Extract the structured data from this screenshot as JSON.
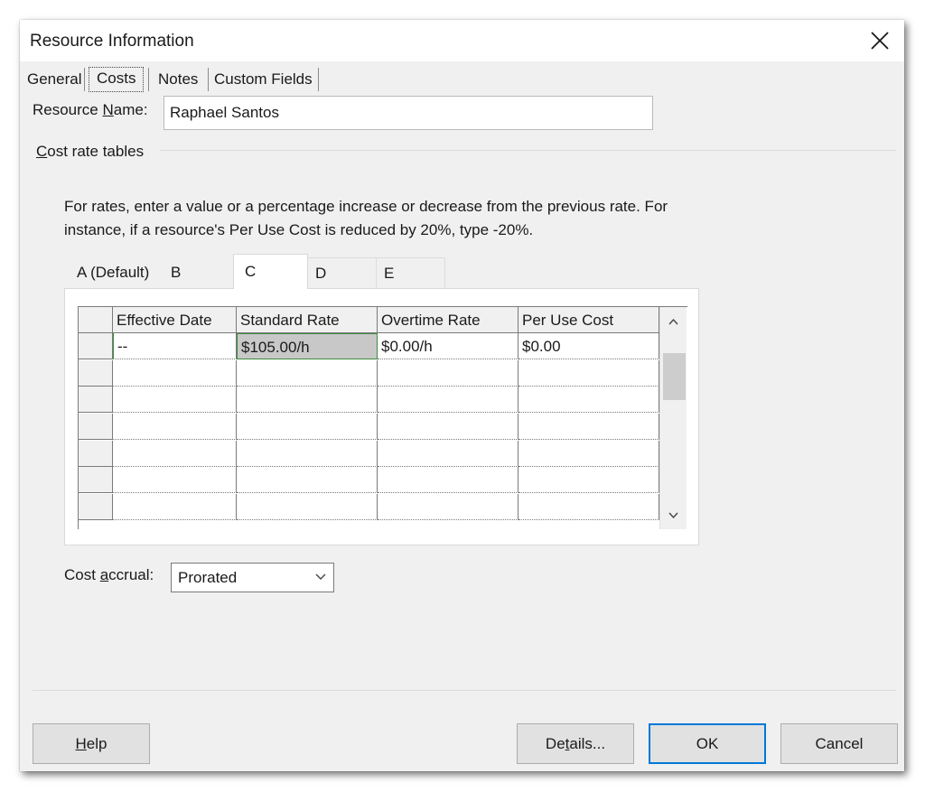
{
  "window": {
    "title": "Resource Information",
    "close_icon": "close-icon"
  },
  "tabs": [
    {
      "label": "General",
      "active": false
    },
    {
      "label": "Costs",
      "active": true
    },
    {
      "label": "Notes",
      "active": false
    },
    {
      "label": "Custom Fields",
      "active": false
    }
  ],
  "resource_name": {
    "label_prefix": "Resource ",
    "label_accel": "N",
    "label_suffix": "ame:",
    "value": "Raphael Santos"
  },
  "cost_rate_tables": {
    "group_label_accel": "C",
    "group_label_rest": "ost rate tables",
    "instructions": "For rates, enter a value or a percentage increase or decrease from the previous rate. For instance, if a resource's Per Use Cost is reduced by 20%, type -20%.",
    "tabs": [
      {
        "label": "A (Default)",
        "active": false
      },
      {
        "label": "B",
        "active": false
      },
      {
        "label": "C",
        "active": true
      },
      {
        "label": "D",
        "active": false
      },
      {
        "label": "E",
        "active": false
      }
    ],
    "columns": [
      "Effective Date",
      "Standard Rate",
      "Overtime Rate",
      "Per Use Cost"
    ],
    "rows": [
      [
        "--",
        "$105.00/h",
        "$0.00/h",
        "$0.00"
      ],
      [
        "",
        "",
        "",
        ""
      ],
      [
        "",
        "",
        "",
        ""
      ],
      [
        "",
        "",
        "",
        ""
      ],
      [
        "",
        "",
        "",
        ""
      ],
      [
        "",
        "",
        "",
        ""
      ],
      [
        "",
        "",
        "",
        ""
      ]
    ],
    "selected_cell": {
      "row": 0,
      "col": 1
    }
  },
  "cost_accrual": {
    "label_prefix": "Cost ",
    "label_accel": "a",
    "label_suffix": "ccrual:",
    "value": "Prorated"
  },
  "buttons": {
    "help_accel": "H",
    "help_rest": "elp",
    "details_prefix": "De",
    "details_accel": "t",
    "details_suffix": "ails...",
    "ok": "OK",
    "cancel": "Cancel"
  },
  "colors": {
    "dialog_bg": "#f0f0f0",
    "selection_border": "#3d8a3d",
    "default_button_border": "#0078d7"
  }
}
